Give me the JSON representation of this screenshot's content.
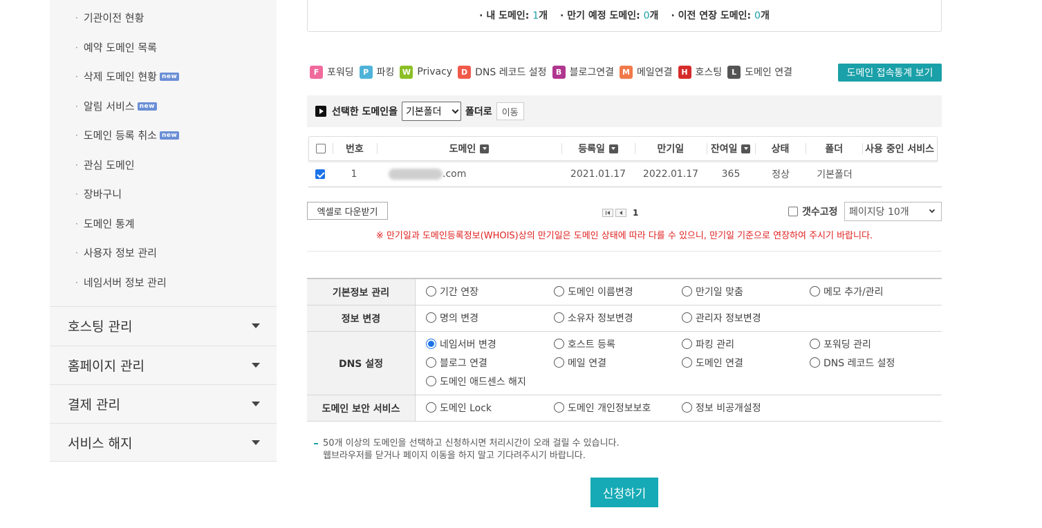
{
  "sidebar": {
    "sub_items": [
      {
        "label": "기관이전 현황",
        "new": false
      },
      {
        "label": "예약 도메인 목록",
        "new": false
      },
      {
        "label": "삭제 도메인 현황",
        "new": true
      },
      {
        "label": "알림 서비스",
        "new": true
      },
      {
        "label": "도메인 등록 취소",
        "new": true
      },
      {
        "label": "관심 도메인",
        "new": false
      },
      {
        "label": "장바구니",
        "new": false
      },
      {
        "label": "도메인 통계",
        "new": false
      },
      {
        "label": "사용자 정보 관리",
        "new": false
      },
      {
        "label": "네임서버 정보 관리",
        "new": false
      }
    ],
    "new_badge": "new",
    "bullet": "·",
    "menus": [
      "호스팅 관리",
      "홈페이지 관리",
      "결제 관리",
      "서비스 해지"
    ]
  },
  "summary": {
    "my_domains_label": "· 내 도메인:",
    "my_domains_value": "1",
    "expiring_label": "· 만기 예정 도메인:",
    "expiring_value": "0",
    "transfer_label": "· 이전 연장 도메인:",
    "transfer_value": "0",
    "unit": "개"
  },
  "legend": [
    {
      "icon": "F",
      "label": "포워딩",
      "color": "#f06a9c"
    },
    {
      "icon": "P",
      "label": "파킹",
      "color": "#4fb3d9"
    },
    {
      "icon": "W",
      "label": "Privacy",
      "color": "#8cbf26"
    },
    {
      "icon": "D",
      "label": "DNS 레코드 설정",
      "color": "#f05a4a"
    },
    {
      "icon": "B",
      "label": "블로그연결",
      "color": "#b0378f"
    },
    {
      "icon": "M",
      "label": "메일연결",
      "color": "#f07a4a"
    },
    {
      "icon": "H",
      "label": "호스팅",
      "color": "#d62b2b"
    },
    {
      "icon": "L",
      "label": "도메인 연결",
      "color": "#555555"
    }
  ],
  "stats_button": "도메인 접속통계 보기",
  "move_bar": {
    "label": "선택한 도메인을",
    "folder_value": "기본폴더",
    "suffix": "폴더로",
    "move_button": "이동"
  },
  "table": {
    "headers": [
      "번호",
      "도메인",
      "등록일",
      "만기일",
      "잔여일",
      "상태",
      "폴더",
      "사용 중인 서비스"
    ],
    "rows": [
      {
        "no": "1",
        "domain_suffix": ".com",
        "registered": "2021.01.17",
        "expires": "2022.01.17",
        "remaining": "365",
        "status": "정상",
        "folder": "기본폴더",
        "checked": true
      }
    ]
  },
  "excel_button": "엑셀로 다운받기",
  "pager": {
    "current": "1"
  },
  "fix_count_label": "갯수고정",
  "per_page_value": "페이지당 10개",
  "notice": "※ 만기일과 도메인등록정보(WHOIS)상의 만기일은 도메인 상태에 따라 다를 수 있으니, 만기일 기준으로 연장하여 주시기 바랍니다.",
  "options": [
    {
      "label": "기본정보 관리",
      "items": [
        "기간 연장",
        "도메인 이름변경",
        "만기일 맞춤",
        "메모 추가/관리"
      ]
    },
    {
      "label": "정보 변경",
      "items": [
        "명의 변경",
        "소유자 정보변경",
        "관리자 정보변경"
      ]
    },
    {
      "label": "DNS 설정",
      "items": [
        "네임서버 변경",
        "호스트 등록",
        "파킹 관리",
        "포워딩 관리",
        "블로그 연결",
        "메일 연결",
        "도메인 연결",
        "DNS 레코드 설정",
        "도메인 애드센스 해지"
      ]
    },
    {
      "label": "도메인 보안 서비스",
      "items": [
        "도메인 Lock",
        "도메인 개인정보보호",
        "정보 비공개설정"
      ]
    }
  ],
  "selected_option": "네임서버 변경",
  "info_lines": [
    "50개 이상의 도메인을 선택하고 신청하시면 처리시간이 오래 걸릴 수 있습니다.",
    "웹브라우저를 닫거나 페이지 이동을 하지 말고 기다려주시기 바랍니다."
  ],
  "apply_button": "신청하기",
  "colors": {
    "accent": "#1aa0a8",
    "notice": "#e02020",
    "checkbox": "#1a73e8"
  }
}
